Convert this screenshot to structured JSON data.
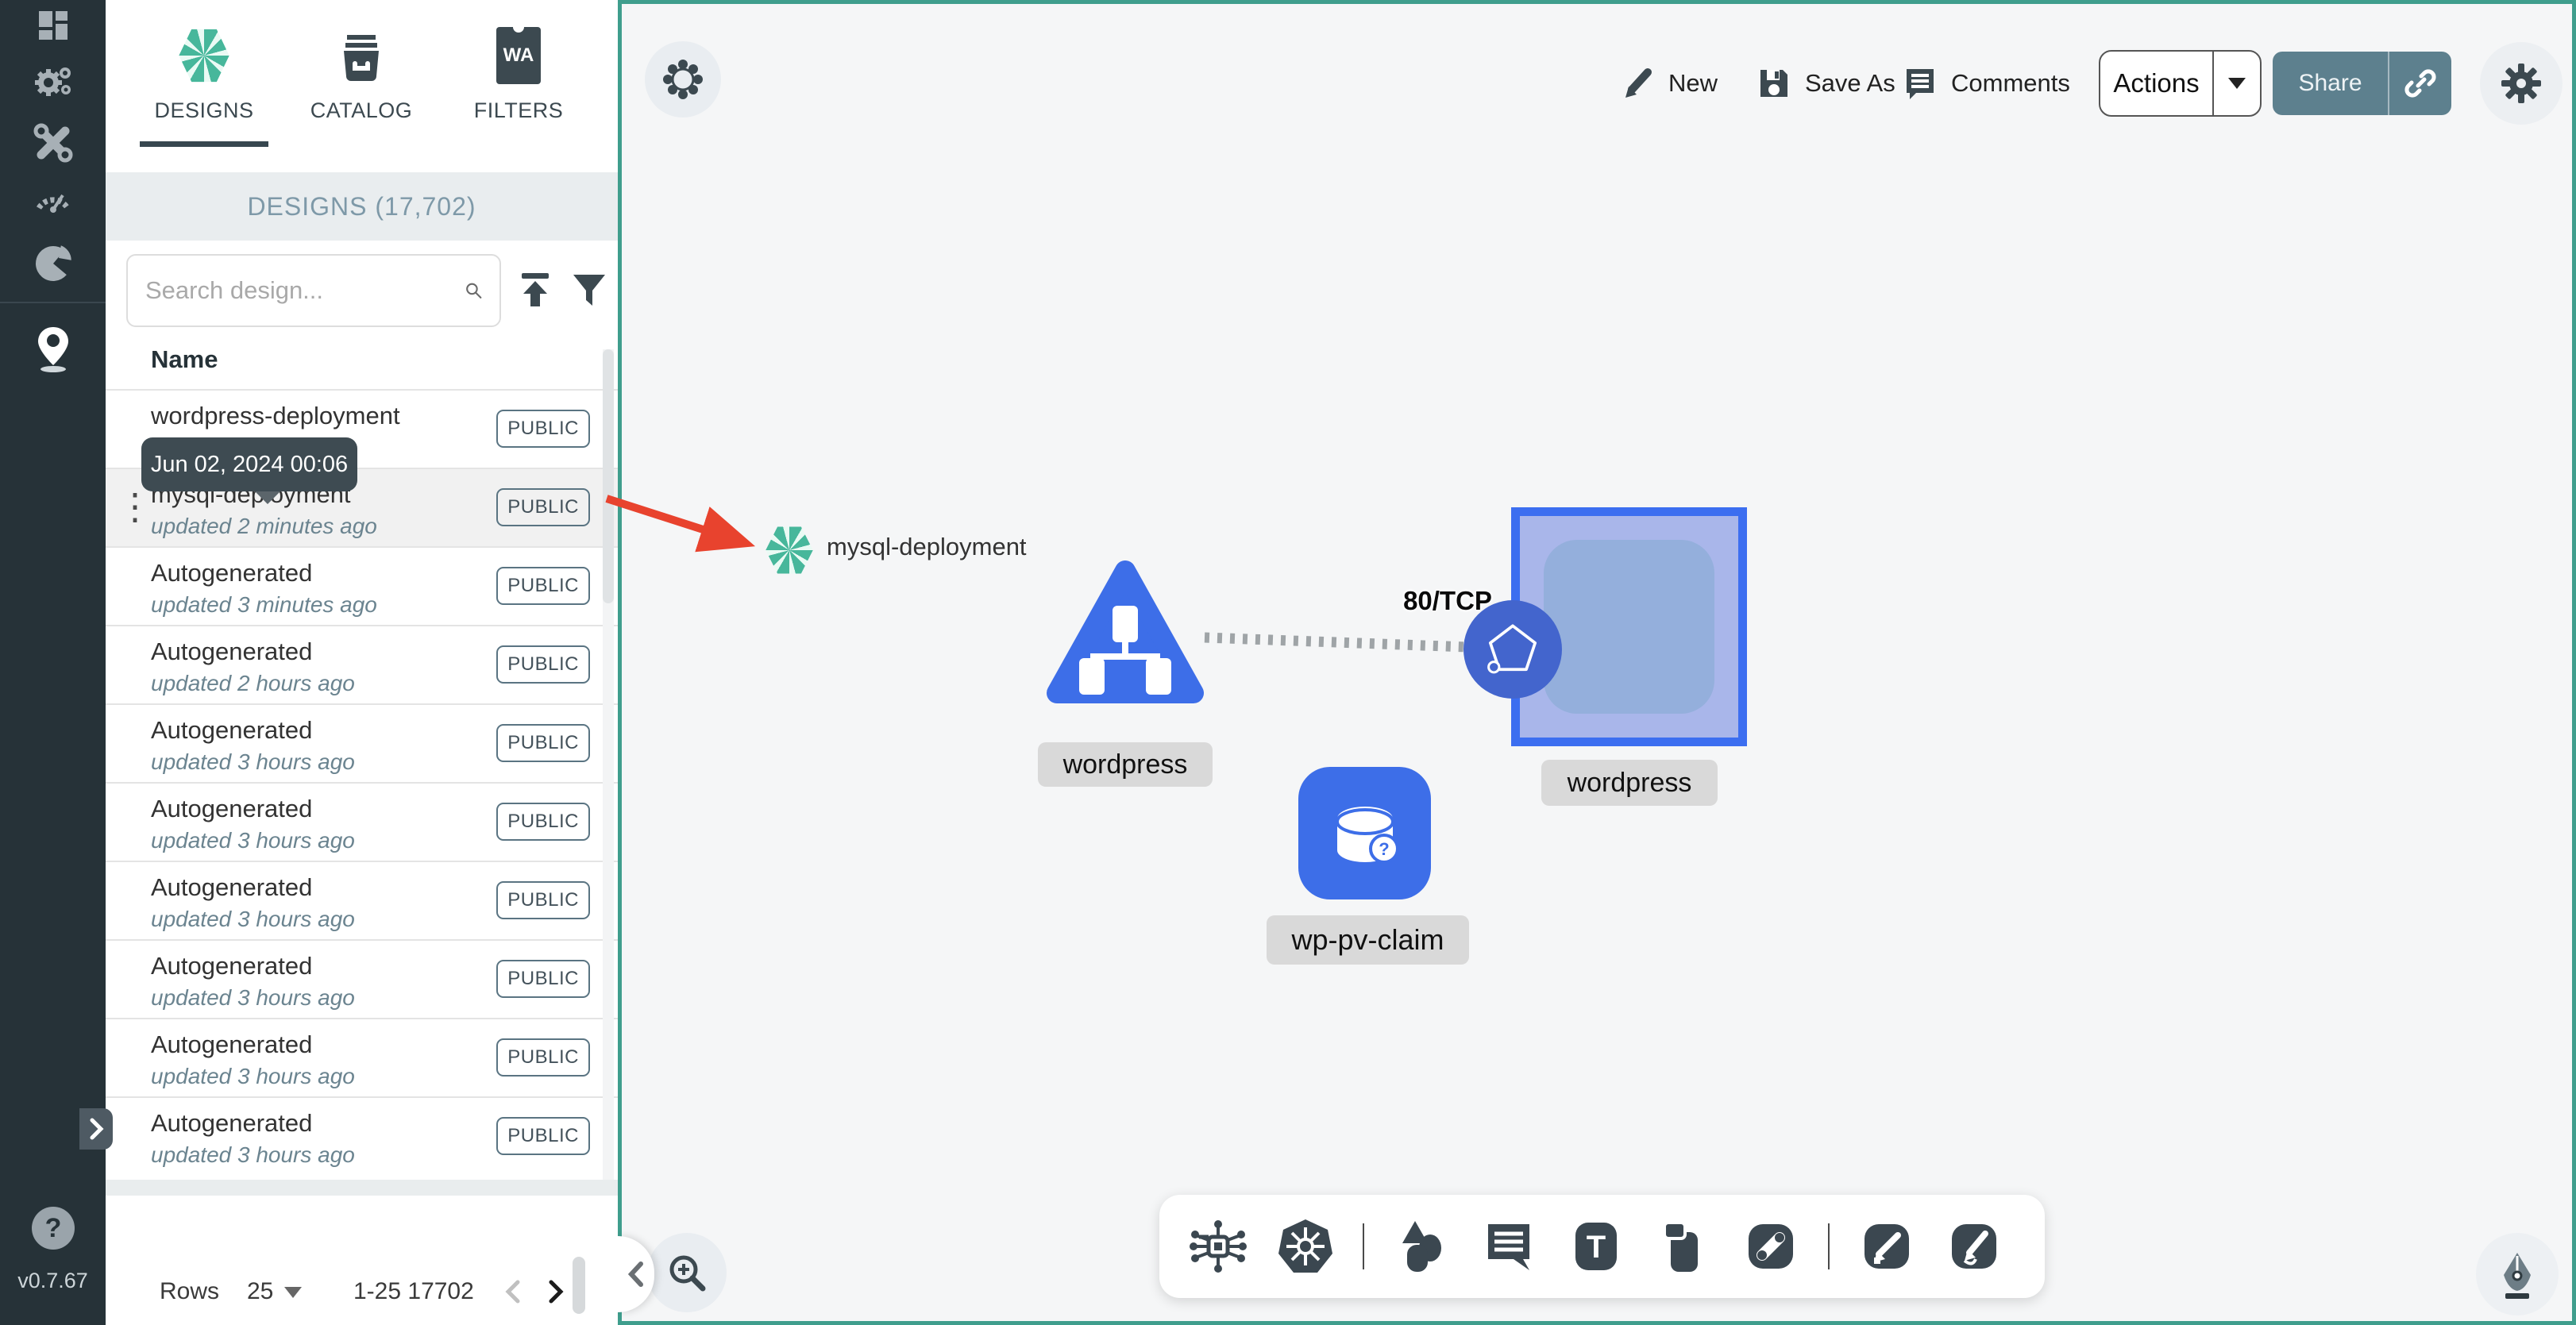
{
  "sidebar": {
    "icons": [
      "dashboard",
      "lifecycle",
      "configuration",
      "performance",
      "extensions",
      "kanvas"
    ],
    "help_glyph": "?",
    "version": "v0.7.67"
  },
  "panel": {
    "tabs": [
      {
        "label": "DESIGNS",
        "icon": "meshery-logo",
        "active": true
      },
      {
        "label": "CATALOG",
        "icon": "catalog-archive",
        "active": false
      },
      {
        "label": "FILTERS",
        "icon": "wasm-filter",
        "active": false
      }
    ],
    "filters_badge": "WA",
    "header_title": "DESIGNS (17,702)",
    "search_placeholder": "Search design...",
    "column_name": "Name",
    "tooltip_date": "Jun 02, 2024 00:06",
    "rows": [
      {
        "name": "wordpress-deployment",
        "updated": "",
        "badge": "PUBLIC",
        "hovered": false
      },
      {
        "name": "mysql-deployment",
        "updated": "updated 2 minutes ago",
        "badge": "PUBLIC",
        "hovered": true
      },
      {
        "name": "Autogenerated",
        "updated": "updated 3 minutes ago",
        "badge": "PUBLIC",
        "hovered": false
      },
      {
        "name": "Autogenerated",
        "updated": "updated 2 hours ago",
        "badge": "PUBLIC",
        "hovered": false
      },
      {
        "name": "Autogenerated",
        "updated": "updated 3 hours ago",
        "badge": "PUBLIC",
        "hovered": false
      },
      {
        "name": "Autogenerated",
        "updated": "updated 3 hours ago",
        "badge": "PUBLIC",
        "hovered": false
      },
      {
        "name": "Autogenerated",
        "updated": "updated 3 hours ago",
        "badge": "PUBLIC",
        "hovered": false
      },
      {
        "name": "Autogenerated",
        "updated": "updated 3 hours ago",
        "badge": "PUBLIC",
        "hovered": false
      },
      {
        "name": "Autogenerated",
        "updated": "updated 3 hours ago",
        "badge": "PUBLIC",
        "hovered": false
      },
      {
        "name": "Autogenerated",
        "updated": "updated 3 hours ago",
        "badge": "PUBLIC",
        "hovered": false
      }
    ],
    "pagination": {
      "rows_label": "Rows",
      "page_size": "25",
      "range": "1-25 17702"
    }
  },
  "toolbar": {
    "new_label": "New",
    "save_as_label": "Save As",
    "comments_label": "Comments",
    "actions_label": "Actions",
    "share_label": "Share"
  },
  "canvas": {
    "design_node_label": "mysql-deployment",
    "service_label": "wordpress",
    "deployment_label": "wordpress",
    "pvc_label": "wp-pv-claim",
    "pvc_badge": "?",
    "edge_label": "80/TCP",
    "text_tool_glyph": "T"
  },
  "colors": {
    "accent_teal": "#3f9e8d",
    "sidebar_dark": "#263238",
    "node_blue": "#3d6ee8",
    "share_gray": "#5d808e",
    "arrow_red": "#e8432e"
  }
}
